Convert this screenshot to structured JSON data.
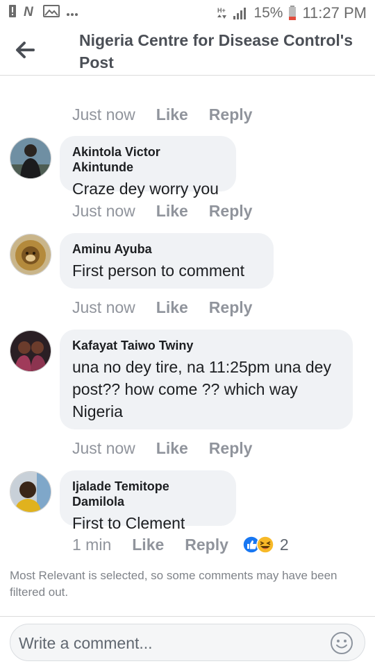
{
  "status_bar": {
    "battery": "15%",
    "time": "11:27 PM"
  },
  "header": {
    "title": "Nigeria Centre for Disease Control's Post"
  },
  "top_meta": {
    "time": "Just now",
    "like": "Like",
    "reply": "Reply"
  },
  "comments": [
    {
      "author": "Akintola Victor Akintunde",
      "text": "Craze dey worry you",
      "time": "Just now",
      "like": "Like",
      "reply": "Reply"
    },
    {
      "author": "Aminu Ayuba",
      "text": "First person to comment",
      "time": "Just now",
      "like": "Like",
      "reply": "Reply"
    },
    {
      "author": "Kafayat Taiwo Twiny",
      "text": "una no dey tire, na 11:25pm una dey post?? how come ?? which way Nigeria",
      "time": "Just now",
      "like": "Like",
      "reply": "Reply"
    },
    {
      "author": "Ijalade Temitope Damilola",
      "text": "First to Clement",
      "time": "1 min",
      "like": "Like",
      "reply": "Reply",
      "reactions": {
        "icons": [
          "like-reaction-icon",
          "haha-reaction-icon"
        ],
        "count": "2"
      }
    }
  ],
  "filter_note": "Most Relevant is selected, so some comments may have been filtered out.",
  "composer": {
    "placeholder": "Write a comment..."
  },
  "colors": {
    "bubble": "#f0f2f5",
    "meta_text": "#90949c",
    "like_blue": "#1877f2",
    "haha_yellow": "#f7b928"
  }
}
